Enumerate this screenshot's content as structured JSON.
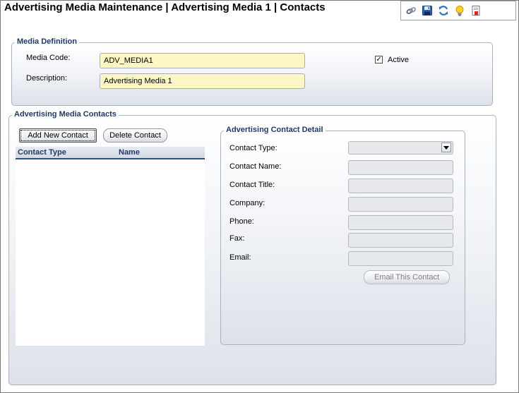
{
  "page": {
    "title": "Advertising Media Maintenance | Advertising Media 1 | Contacts"
  },
  "toolbar": {
    "icons": [
      "link-icon",
      "save-icon",
      "refresh-icon",
      "lightbulb-icon",
      "report-icon"
    ]
  },
  "media_definition": {
    "legend": "Media Definition",
    "media_code_label": "Media Code:",
    "media_code_value": "ADV_MEDIA1",
    "description_label": "Description:",
    "description_value": "Advertising Media 1",
    "active_label": "Active",
    "active_checked": true
  },
  "contacts": {
    "legend": "Advertising Media Contacts",
    "add_button": "Add New Contact",
    "delete_button": "Delete Contact",
    "columns": [
      "Contact Type",
      "Name"
    ],
    "rows": []
  },
  "contact_detail": {
    "legend": "Advertising Contact Detail",
    "contact_type_label": "Contact Type:",
    "contact_name_label": "Contact Name:",
    "contact_title_label": "Contact Title:",
    "company_label": "Company:",
    "phone_label": "Phone:",
    "fax_label": "Fax:",
    "email_label": "Email:",
    "email_button": "Email This Contact"
  }
}
